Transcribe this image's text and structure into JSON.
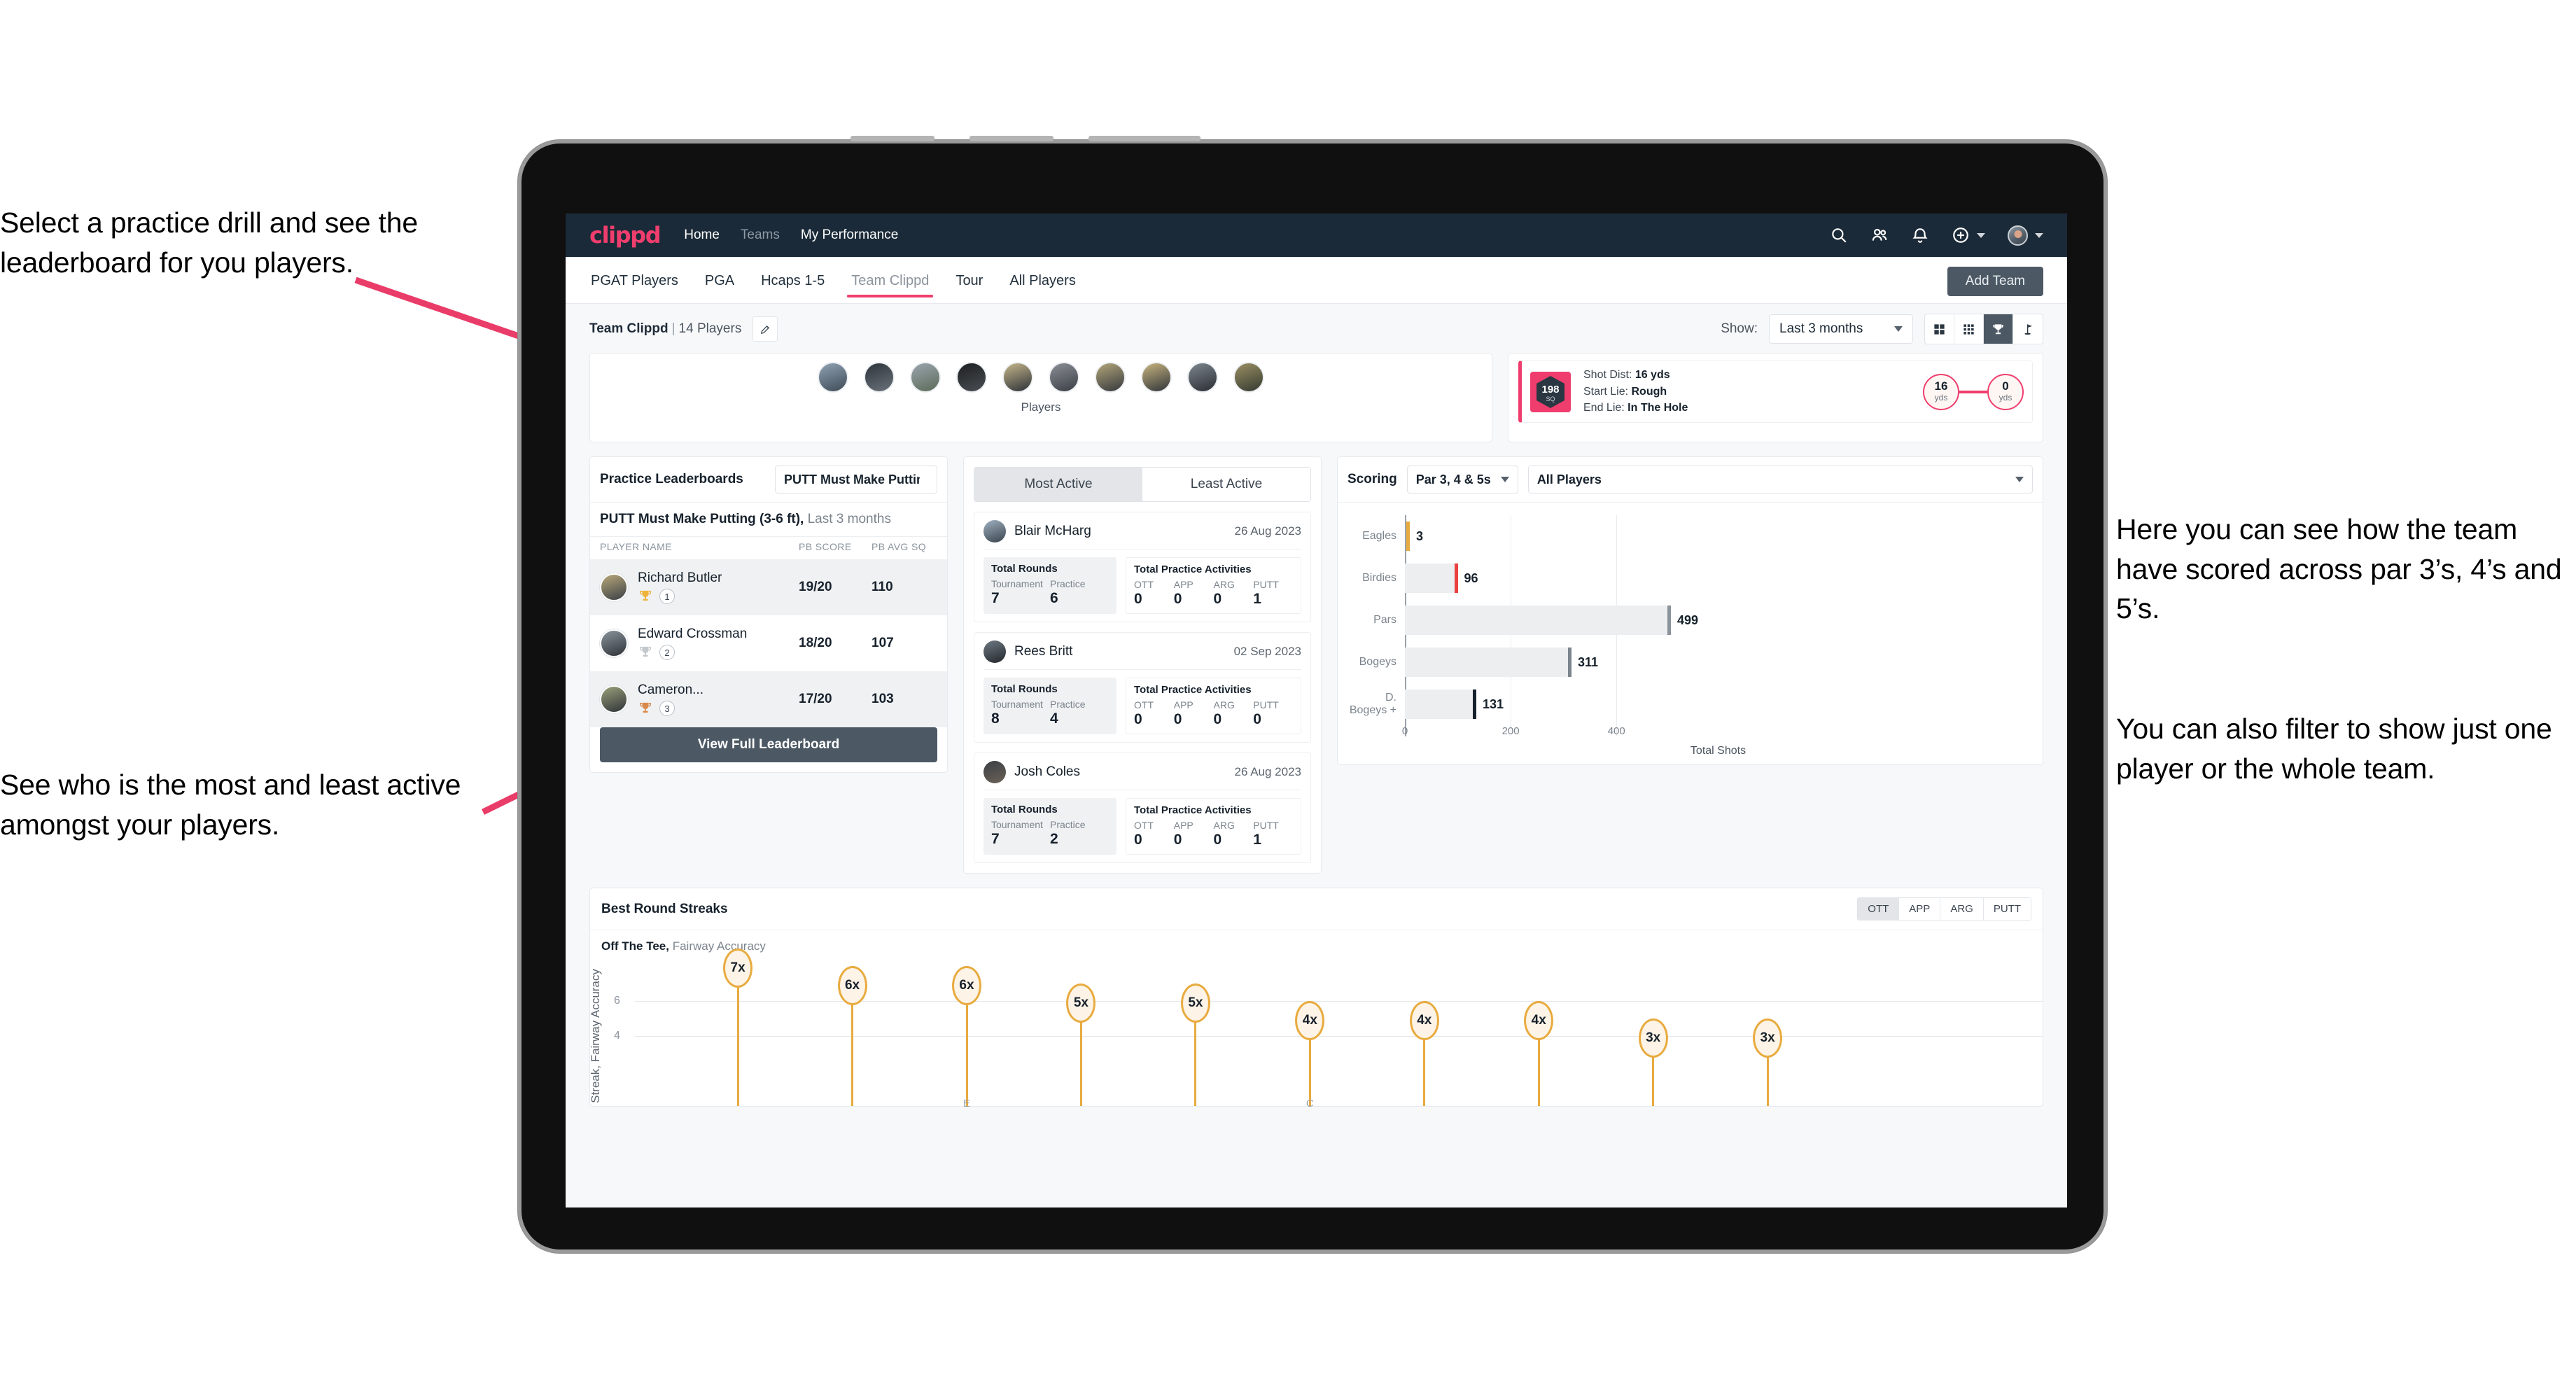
{
  "annotations": {
    "left_top": "Select a practice drill and see the leaderboard for you players.",
    "left_bottom": "See who is the most and least active amongst your players.",
    "right_top": "Here you can see how the team have scored across par 3’s, 4’s and 5’s.",
    "right_bottom": "You can also filter to show just one player or the whole team."
  },
  "header": {
    "logo": "clippd",
    "nav": [
      {
        "label": "Home",
        "active": true
      },
      {
        "label": "Teams",
        "active": false
      },
      {
        "label": "My Performance",
        "active": true
      }
    ],
    "icons": [
      "search-icon",
      "people-icon",
      "bell-icon",
      "plus-circle-icon",
      "avatar"
    ],
    "accent_color": "#ef3e6d",
    "bar_color": "#1b2a38"
  },
  "tabs": {
    "items": [
      "PGAT Players",
      "PGA",
      "Hcaps 1-5",
      "Team Clippd",
      "Tour",
      "All Players"
    ],
    "active": "Team Clippd",
    "add_team_label": "Add Team"
  },
  "subbar": {
    "team_name": "Team Clippd",
    "separator": "|",
    "player_count": "14 Players",
    "edit_icon": "pencil-icon",
    "show_label": "Show:",
    "range_value": "Last 3 months",
    "view_modes": [
      "grid-large-icon",
      "grid-small-icon",
      "trophy-icon",
      "flag-icon"
    ],
    "view_active_index": 2
  },
  "players_strip": {
    "label": "Players",
    "count": 10
  },
  "shot_card": {
    "sq_value": "198",
    "sq_unit": "SQ",
    "lines": [
      {
        "key": "Shot Dist:",
        "value": "16 yds"
      },
      {
        "key": "Start Lie:",
        "value": "Rough"
      },
      {
        "key": "End Lie:",
        "value": "In The Hole"
      }
    ],
    "start_dist": "16",
    "start_unit": "yds",
    "end_dist": "0",
    "end_unit": "yds"
  },
  "leaderboard": {
    "title": "Practice Leaderboards",
    "drill_select": "PUTT Must Make Putting ...",
    "subtitle_bold": "PUTT Must Make Putting (3-6 ft),",
    "subtitle_light": "Last 3 months",
    "columns": [
      "PLAYER NAME",
      "PB SCORE",
      "PB AVG SQ"
    ],
    "rows": [
      {
        "name": "Richard Butler",
        "rank": "1",
        "medal": "gold",
        "pb_score": "19/20",
        "pb_avg_sq": "110"
      },
      {
        "name": "Edward Crossman",
        "rank": "2",
        "medal": "silver",
        "pb_score": "18/20",
        "pb_avg_sq": "107"
      },
      {
        "name": "Cameron...",
        "rank": "3",
        "medal": "bronze",
        "pb_score": "17/20",
        "pb_avg_sq": "103"
      }
    ],
    "cta": "View Full Leaderboard"
  },
  "activity": {
    "tabs": [
      "Most Active",
      "Least Active"
    ],
    "active_tab": "Most Active",
    "rounds_title": "Total Rounds",
    "rounds_keys": [
      "Tournament",
      "Practice"
    ],
    "practice_title": "Total Practice Activities",
    "practice_keys": [
      "OTT",
      "APP",
      "ARG",
      "PUTT"
    ],
    "cards": [
      {
        "name": "Blair McHarg",
        "date": "26 Aug 2023",
        "rounds": [
          "7",
          "6"
        ],
        "practice": [
          "0",
          "0",
          "0",
          "1"
        ]
      },
      {
        "name": "Rees Britt",
        "date": "02 Sep 2023",
        "rounds": [
          "8",
          "4"
        ],
        "practice": [
          "0",
          "0",
          "0",
          "0"
        ]
      },
      {
        "name": "Josh Coles",
        "date": "26 Aug 2023",
        "rounds": [
          "7",
          "2"
        ],
        "practice": [
          "0",
          "0",
          "0",
          "1"
        ]
      }
    ]
  },
  "scoring": {
    "title": "Scoring",
    "par_filter": "Par 3, 4 & 5s",
    "player_filter": "All Players"
  },
  "streaks": {
    "title": "Best Round Streaks",
    "toggle": [
      "OTT",
      "APP",
      "ARG",
      "PUTT"
    ],
    "toggle_active": "OTT",
    "sub_bold": "Off The Tee,",
    "sub_light": "Fairway Accuracy"
  },
  "chart_data": [
    {
      "type": "bar",
      "orientation": "horizontal",
      "title": "Scoring",
      "categories": [
        "Eagles",
        "Birdies",
        "Pars",
        "Bogeys",
        "D. Bogeys +"
      ],
      "values": [
        3,
        96,
        499,
        311,
        131
      ],
      "cap_colors": [
        "#e8ab3f",
        "#e8413f",
        "#8a939c",
        "#7b848d",
        "#16212c"
      ],
      "xlabel": "Total Shots",
      "ylabel": "",
      "xlim": [
        0,
        540
      ],
      "xticks": [
        0,
        200,
        400
      ],
      "grid": true,
      "legend": "none"
    },
    {
      "type": "scatter",
      "title": "Best Round Streaks",
      "subtitle": "Off The Tee, Fairway Accuracy",
      "ylabel": "Streak, Fairway Accuracy",
      "xlabel": "",
      "ylim": [
        0,
        8
      ],
      "yticks": [
        4,
        6
      ],
      "grid": true,
      "labels": [
        "7x",
        "6x",
        "6x",
        "5x",
        "5x",
        "4x",
        "4x",
        "4x",
        "3x",
        "3x"
      ],
      "values": [
        7,
        6,
        6,
        5,
        5,
        4,
        4,
        4,
        3,
        3
      ],
      "xticks_partial": [
        "E",
        "C"
      ]
    }
  ]
}
